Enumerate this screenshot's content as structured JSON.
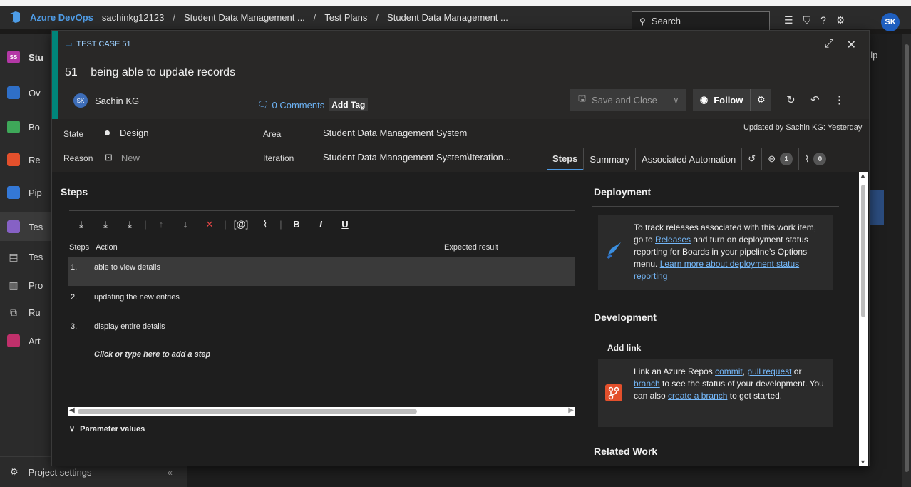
{
  "topbar": {
    "brand": "Azure DevOps",
    "breadcrumbs": [
      "sachinkg12123",
      "Student Data Management ...",
      "Test Plans",
      "Student Data Management ..."
    ],
    "search_placeholder": "Search",
    "user_initials": "SK"
  },
  "leftnav": {
    "project_badge": "SS",
    "items": [
      {
        "label": "Stu",
        "color": "#b338a6"
      },
      {
        "label": "Ov",
        "color": "#2f6fc7"
      },
      {
        "label": "Bo",
        "color": "#3ea859"
      },
      {
        "label": "Re",
        "color": "#e3502c"
      },
      {
        "label": "Pip",
        "color": "#3478d6"
      },
      {
        "label": "Tes",
        "color": "#8661c5"
      },
      {
        "label": "Tes",
        "color": "#888888"
      },
      {
        "label": "Pro",
        "color": "#888888"
      },
      {
        "label": "Ru",
        "color": "#888888"
      },
      {
        "label": "Art",
        "color": "#c0306b"
      }
    ],
    "footer_label": "Project settings"
  },
  "background": {
    "help_text": "elp"
  },
  "dialog": {
    "type_label": "TEST CASE 51",
    "id": "51",
    "title": "being able to update records",
    "owner": {
      "initials": "SK",
      "name": "Sachin KG"
    },
    "comments_label": "0 Comments",
    "add_tag_label": "Add Tag",
    "toolbar": {
      "save_close": "Save and Close",
      "follow": "Follow"
    },
    "fields": {
      "state_label": "State",
      "state_value": "Design",
      "reason_label": "Reason",
      "reason_value": "New",
      "area_label": "Area",
      "area_value": "Student Data Management System",
      "iteration_label": "Iteration",
      "iteration_value": "Student Data Management System\\Iteration..."
    },
    "updated_text": "Updated by Sachin KG: Yesterday",
    "tabs": [
      {
        "label": "Steps"
      },
      {
        "label": "Summary"
      },
      {
        "label": "Associated Automation"
      }
    ],
    "links_count": "1",
    "attachments_count": "0",
    "steps": {
      "heading": "Steps",
      "col_steps": "Steps",
      "col_action": "Action",
      "col_expected": "Expected result",
      "rows": [
        {
          "num": "1.",
          "action": "able to view details"
        },
        {
          "num": "2.",
          "action": "updating the new entries"
        },
        {
          "num": "3.",
          "action": "display entire details"
        }
      ],
      "add_step": "Click or type here to add a step",
      "params": "Parameter values"
    },
    "deployment": {
      "heading": "Deployment",
      "text1": "To track releases associated with this work item, go to ",
      "link1": "Releases",
      "text2": " and turn on deployment status reporting for Boards in your pipeline's Options menu. ",
      "link2": "Learn more about deployment status reporting"
    },
    "development": {
      "heading": "Development",
      "add_link": "Add link",
      "text1": "Link an Azure Repos ",
      "link_commit": "commit",
      "sep1": ", ",
      "link_pr": "pull request",
      "text2": " or ",
      "link_branch": "branch",
      "text3": " to see the status of your development. You can also ",
      "link_create": "create a branch",
      "text4": " to get started."
    },
    "related_work": {
      "heading": "Related Work"
    }
  }
}
